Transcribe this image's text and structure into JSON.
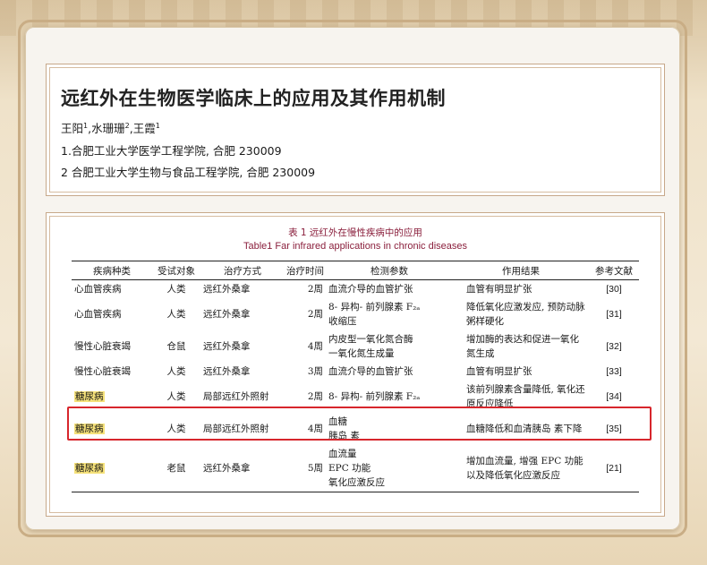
{
  "header": {
    "title": "远红外在生物医学临床上的应用及其作用机制",
    "authors": [
      {
        "name": "王阳",
        "sup": "1"
      },
      {
        "name": "水珊珊",
        "sup": "2"
      },
      {
        "name": "王霞",
        "sup": "1"
      }
    ],
    "affiliation_1": "1.合肥工业大学医学工程学院, 合肥 230009",
    "affiliation_2": "2 合肥工业大学生物与食品工程学院, 合肥 230009"
  },
  "table": {
    "caption_zh": "表 1    远红外在慢性疾病中的应用",
    "caption_en": "Table1    Far infrared applications in chronic diseases",
    "columns": [
      "疾病种类",
      "受试对象",
      "治疗方式",
      "治疗时间",
      "检测参数",
      "作用结果",
      "参考文献"
    ],
    "rows": [
      {
        "disease": "心血管疾病",
        "subject": "人类",
        "method": "远红外桑拿",
        "time": "2周",
        "params": [
          "血流介导的血管扩张"
        ],
        "result": "血管有明显扩张",
        "ref": "[30]",
        "highlight": false
      },
      {
        "disease": "心血管疾病",
        "subject": "人类",
        "method": "远红外桑拿",
        "time": "2周",
        "params": [
          "8- 异构- 前列腺素 F₂ₐ",
          "收缩压"
        ],
        "result": "降低氧化应激发应, 预防动脉粥样硬化",
        "ref": "[31]",
        "highlight": false
      },
      {
        "disease": "慢性心脏衰竭",
        "subject": "仓鼠",
        "method": "远红外桑拿",
        "time": "4周",
        "params": [
          "内皮型一氧化氮合酶",
          "一氧化氮生成量"
        ],
        "result": "增加酶的表达和促进一氧化氮生成",
        "ref": "[32]",
        "highlight": false
      },
      {
        "disease": "慢性心脏衰竭",
        "subject": "人类",
        "method": "远红外桑拿",
        "time": "3周",
        "params": [
          "血流介导的血管扩张"
        ],
        "result": "血管有明显扩张",
        "ref": "[33]",
        "highlight": false
      },
      {
        "disease": "糖尿病",
        "subject": "人类",
        "method": "局部远红外照射",
        "time": "2周",
        "params": [
          "8- 异构- 前列腺素 F₂ₐ"
        ],
        "result": "该前列腺素含量降低, 氧化还原反应降低",
        "ref": "[34]",
        "highlight": true
      },
      {
        "disease": "糖尿病",
        "subject": "人类",
        "method": "局部远红外照射",
        "time": "4周",
        "params": [
          "血糖",
          "胰岛 素"
        ],
        "result": "血糖降低和血清胰岛 素下降",
        "ref": "[35]",
        "highlight": true
      },
      {
        "disease": "糖尿病",
        "subject": "老鼠",
        "method": "远红外桑拿",
        "time": "5周",
        "params": [
          "血流量",
          "EPC 功能",
          "氧化应激反应"
        ],
        "result": "增加血流量, 增强 EPC 功能以及降低氧化应激反应",
        "ref": "[21]",
        "highlight": true
      }
    ]
  },
  "colors": {
    "caption": "#8a1f3c",
    "highlight": "#f6e27a",
    "red_box": "#d7262c"
  }
}
